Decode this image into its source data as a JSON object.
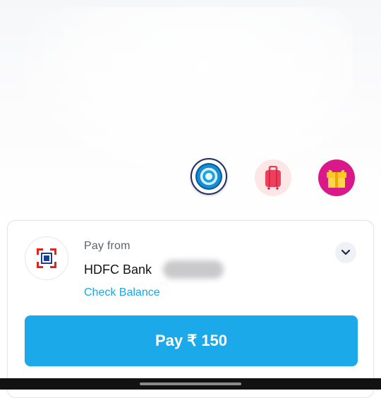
{
  "pay_card": {
    "pay_from_label": "Pay from",
    "bank_name": "HDFC Bank",
    "check_balance_label": "Check Balance",
    "pay_button_label": "Pay ₹ 150"
  },
  "offer_icons": [
    "spin-wheel-icon",
    "luggage-icon",
    "gift-icon"
  ],
  "colors": {
    "accent": "#1ba9e9",
    "link": "#1aa7e6",
    "gift_bg": "#d9198a",
    "bag_bg": "#fde6e6"
  }
}
